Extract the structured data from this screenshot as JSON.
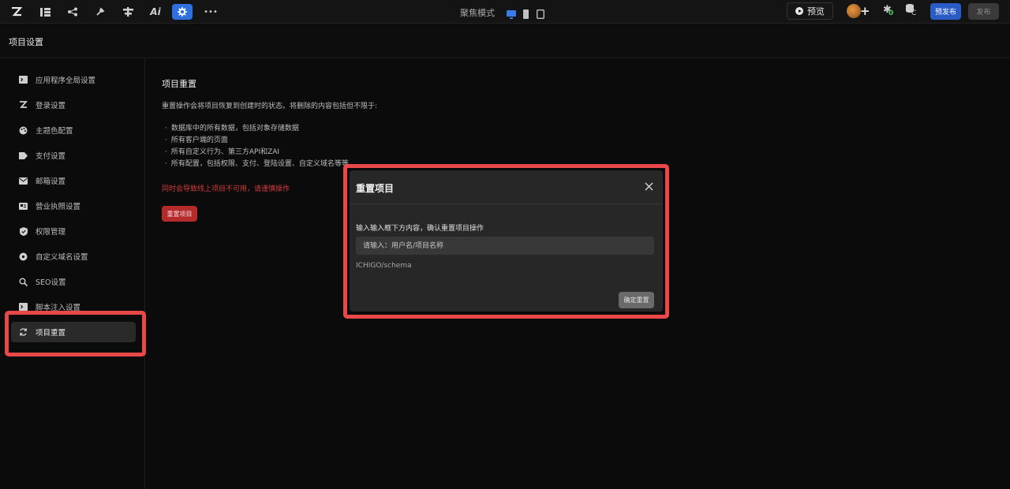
{
  "toolbar": {
    "icons": [
      "logo-icon",
      "pages-icon",
      "flow-icon",
      "tools-icon",
      "components-icon",
      "ai-icon",
      "settings-icon",
      "more-icon"
    ],
    "ai_label": "Ai",
    "more_label": "•••",
    "focus_mode_label": "聚焦模式",
    "preview_label": "预览",
    "bug_count": "0",
    "db_badge": "C",
    "prepublish_label": "预发布",
    "publish_label": "发布",
    "accent_color": "#2f6fe0"
  },
  "page": {
    "title": "项目设置"
  },
  "sidebar": {
    "items": [
      {
        "label": "应用程序全局设置",
        "icon": "terminal-icon"
      },
      {
        "label": "登录设置",
        "icon": "logo-icon"
      },
      {
        "label": "主题色配置",
        "icon": "palette-icon"
      },
      {
        "label": "支付设置",
        "icon": "payment-icon"
      },
      {
        "label": "邮箱设置",
        "icon": "mail-icon"
      },
      {
        "label": "营业执照设置",
        "icon": "license-icon"
      },
      {
        "label": "权限管理",
        "icon": "shield-icon"
      },
      {
        "label": "自定义域名设置",
        "icon": "domain-icon"
      },
      {
        "label": "SEO设置",
        "icon": "search-icon"
      },
      {
        "label": "脚本注入设置",
        "icon": "terminal-icon"
      },
      {
        "label": "项目重置",
        "icon": "reset-icon",
        "active": true
      }
    ]
  },
  "main": {
    "section_title": "项目重置",
    "description": "重置操作会将项目恢复到创建时的状态。将删除的内容包括但不限于:",
    "bullets": [
      "数据库中的所有数据，包括对象存储数据",
      "所有客户端的页面",
      "所有自定义行为、第三方API和ZAI",
      "所有配置，包括权限、支付、登陆设置、自定义域名等等"
    ],
    "warning": "同时会导致线上项目不可用，请谨慎操作",
    "reset_button": "重置项目",
    "warning_color": "#d23c3c"
  },
  "modal": {
    "title": "重置项目",
    "close_icon": "close-icon",
    "prompt": "输入输入框下方内容，确认重置项目操作",
    "input_placeholder": "请输入：用户名/项目名称",
    "input_value": "",
    "hint": "ICHIGO/schema",
    "confirm_button": "确定重置"
  },
  "highlight_color": "#e84848"
}
